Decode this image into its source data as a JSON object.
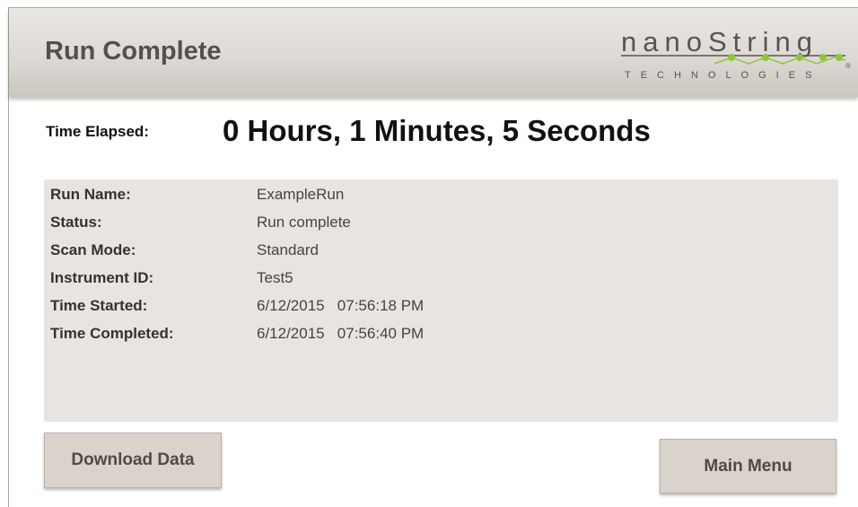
{
  "header": {
    "title": "Run Complete",
    "logo": {
      "wordmark": "nanoString",
      "tagline": "TECHNOLOGIES",
      "registered": "®",
      "brand_color": "#8cc63f"
    }
  },
  "elapsed": {
    "label": "Time Elapsed:",
    "value": "0 Hours, 1 Minutes, 5 Seconds"
  },
  "details": [
    {
      "label": "Run Name:",
      "value": "ExampleRun"
    },
    {
      "label": "Status:",
      "value": "Run complete"
    },
    {
      "label": "Scan Mode:",
      "value": "Standard"
    },
    {
      "label": "Instrument ID:",
      "value": "Test5"
    },
    {
      "label": "Time Started:",
      "value": "6/12/2015   07:56:18 PM"
    },
    {
      "label": "Time Completed:",
      "value": "6/12/2015   07:56:40 PM"
    }
  ],
  "buttons": {
    "download": "Download Data",
    "main_menu": "Main Menu"
  }
}
